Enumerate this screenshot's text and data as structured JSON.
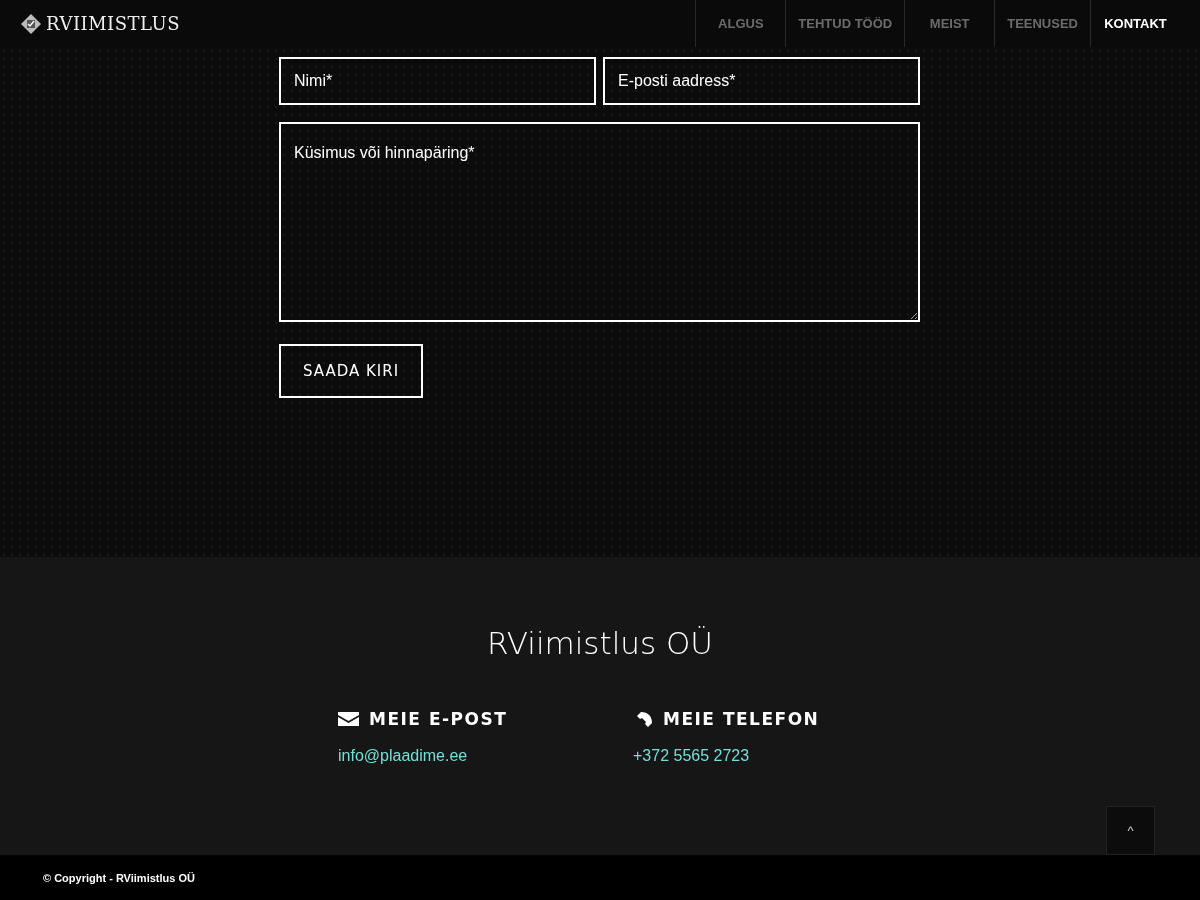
{
  "header": {
    "logo": "RVIIMISTLUS",
    "nav": [
      {
        "label": "ALGUS",
        "selected": false
      },
      {
        "label": "TEHTUD TÖÖD",
        "selected": false
      },
      {
        "label": "MEIST",
        "selected": false
      },
      {
        "label": "TEENUSED",
        "selected": false
      },
      {
        "label": "KONTAKT",
        "selected": true
      }
    ]
  },
  "form": {
    "name": {
      "placeholder": "Nimi*"
    },
    "email": {
      "placeholder": "E-posti aadress*"
    },
    "message": {
      "placeholder": "Küsimus või hinnapäring*"
    },
    "submit": "SAADA KIRI"
  },
  "footer": {
    "title": "RViimistlus OÜ",
    "contacts": [
      {
        "kind": "email",
        "heading": "MEIE E-POST",
        "value": "info@plaadime.ee"
      },
      {
        "kind": "phone",
        "heading": "MEIE TELEFON",
        "value": "+372 5565 2723"
      }
    ],
    "scroll_top": "^"
  },
  "copyright": "© Copyright - RViimistlus OÜ"
}
